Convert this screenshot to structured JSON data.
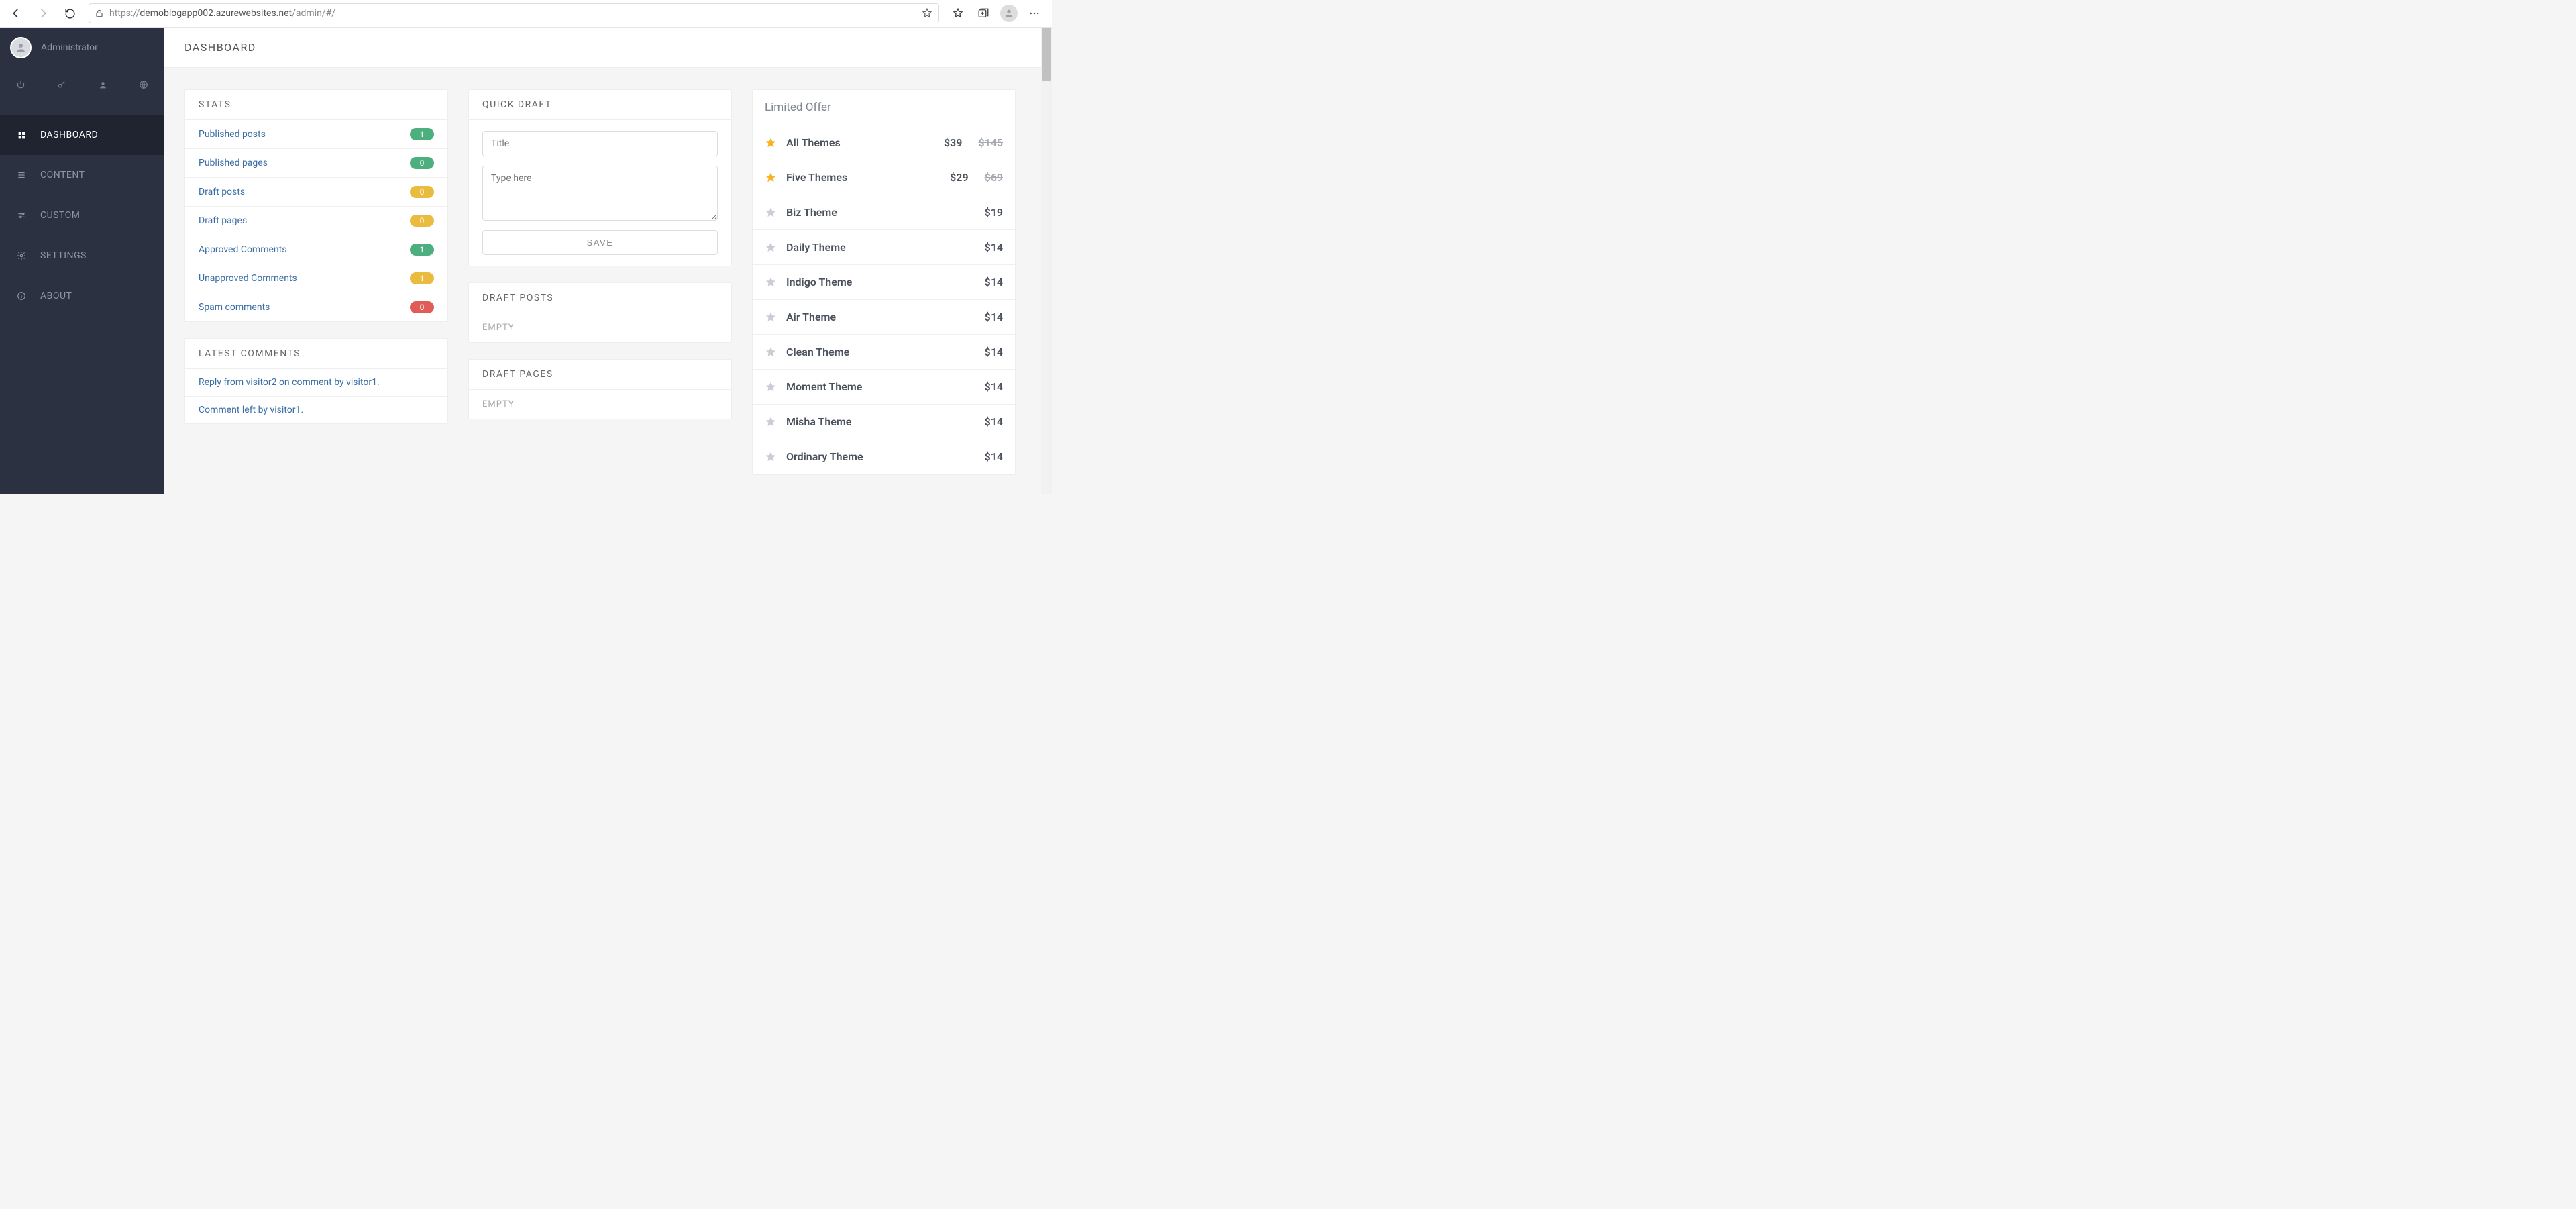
{
  "browser": {
    "url_prefix": "https://",
    "url_host": "demoblogapp002.azurewebsites.net",
    "url_path": "/admin/#/"
  },
  "sidebar": {
    "username": "Administrator",
    "nav": [
      {
        "label": "DASHBOARD",
        "active": true
      },
      {
        "label": "CONTENT",
        "active": false
      },
      {
        "label": "CUSTOM",
        "active": false
      },
      {
        "label": "SETTINGS",
        "active": false
      },
      {
        "label": "ABOUT",
        "active": false
      }
    ]
  },
  "page": {
    "title": "DASHBOARD"
  },
  "stats": {
    "header": "STATS",
    "items": [
      {
        "label": "Published posts",
        "count": "1",
        "color": "green"
      },
      {
        "label": "Published pages",
        "count": "0",
        "color": "green"
      },
      {
        "label": "Draft posts",
        "count": "0",
        "color": "yellow"
      },
      {
        "label": "Draft pages",
        "count": "0",
        "color": "yellow"
      },
      {
        "label": "Approved Comments",
        "count": "1",
        "color": "green"
      },
      {
        "label": "Unapproved Comments",
        "count": "1",
        "color": "yellow"
      },
      {
        "label": "Spam comments",
        "count": "0",
        "color": "red"
      }
    ]
  },
  "latest_comments": {
    "header": "LATEST COMMENTS",
    "items": [
      {
        "text": "Reply from visitor2 on comment by visitor1."
      },
      {
        "text": "Comment left by visitor1."
      }
    ]
  },
  "quick_draft": {
    "header": "QUICK DRAFT",
    "title_placeholder": "Title",
    "body_placeholder": "Type here",
    "save_label": "SAVE"
  },
  "draft_posts": {
    "header": "DRAFT POSTS",
    "empty": "EMPTY"
  },
  "draft_pages": {
    "header": "DRAFT PAGES",
    "empty": "EMPTY"
  },
  "offers": {
    "header": "Limited Offer",
    "items": [
      {
        "name": "All Themes",
        "price": "$39",
        "old_price": "$145",
        "starred": true
      },
      {
        "name": "Five Themes",
        "price": "$29",
        "old_price": "$69",
        "starred": true
      },
      {
        "name": "Biz Theme",
        "price": "$19",
        "old_price": "",
        "starred": false
      },
      {
        "name": "Daily Theme",
        "price": "$14",
        "old_price": "",
        "starred": false
      },
      {
        "name": "Indigo Theme",
        "price": "$14",
        "old_price": "",
        "starred": false
      },
      {
        "name": "Air Theme",
        "price": "$14",
        "old_price": "",
        "starred": false
      },
      {
        "name": "Clean Theme",
        "price": "$14",
        "old_price": "",
        "starred": false
      },
      {
        "name": "Moment Theme",
        "price": "$14",
        "old_price": "",
        "starred": false
      },
      {
        "name": "Misha Theme",
        "price": "$14",
        "old_price": "",
        "starred": false
      },
      {
        "name": "Ordinary Theme",
        "price": "$14",
        "old_price": "",
        "starred": false
      }
    ]
  }
}
